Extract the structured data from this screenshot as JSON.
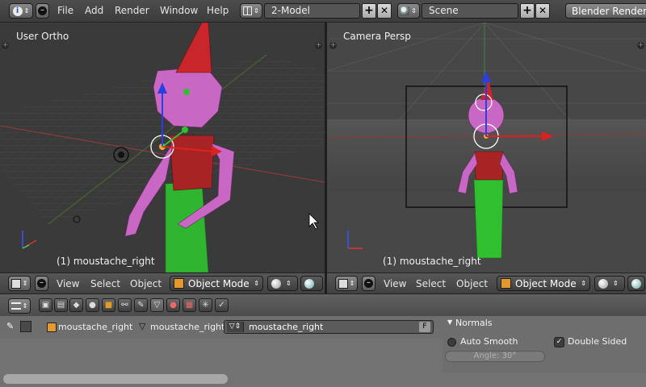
{
  "topbar": {
    "menus": [
      "File",
      "Add",
      "Render",
      "Window",
      "Help"
    ],
    "layout": "2-Model",
    "scene": "Scene",
    "engine": "Blender Render",
    "plus_glyph": "+",
    "close_glyph": "✕"
  },
  "viewport_left": {
    "label": "User Ortho",
    "object": "(1) moustache_right"
  },
  "viewport_right": {
    "label": "Camera Persp",
    "object": "(1) moustache_right"
  },
  "view_header": {
    "view": "View",
    "select": "Select",
    "object": "Object",
    "mode": "Object Mode"
  },
  "properties": {
    "pin_glyph": "✎",
    "breadcrumb_object": "moustache_right",
    "breadcrumb_mesh": "moustache_right",
    "mesh_name": "moustache_right",
    "fake_user": "F"
  },
  "normals_panel": {
    "title": "Normals",
    "auto_smooth": "Auto Smooth",
    "double_sided": "Double Sided",
    "angle": "Angle: 30°",
    "auto_smooth_checked": false,
    "double_sided_checked": true
  },
  "colors": {
    "viewport_bg": "#393939",
    "x_axis": "#b53a3a",
    "y_axis": "#7fa13a",
    "character_body": "#c968c4",
    "character_hat": "#c8262b",
    "character_shirt": "#a82424",
    "character_legs": "#2fbf2f"
  }
}
